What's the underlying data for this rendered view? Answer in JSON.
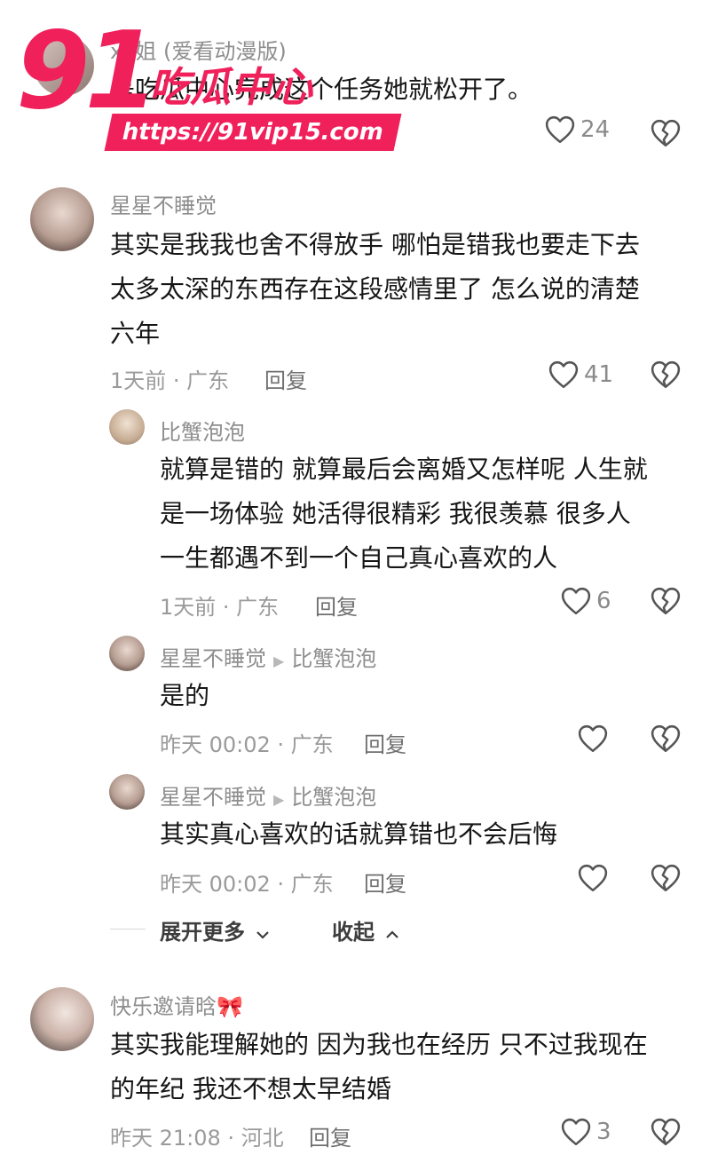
{
  "top_comment": {
    "name": "xx姐 (爱看动漫版)",
    "text": "是吃瓜中心完成这个任务她就松开了。",
    "reply": "回复",
    "likes": "24"
  },
  "comment1": {
    "name": "星星不睡觉",
    "lines": [
      "其实是我我也舍不得放手 哪怕是错我也要走下去",
      "太多太深的东西存在这段感情里了 怎么说的清楚",
      "六年"
    ],
    "time_location": "1天前 · 广东",
    "reply": "回复",
    "likes": "41"
  },
  "reply1": {
    "name": "比蟹泡泡",
    "lines": [
      "就算是错的 就算最后会离婚又怎样呢 人生就",
      "是一场体验 她活得很精彩 我很羡慕 很多人",
      "一生都遇不到一个自己真心喜欢的人"
    ],
    "time_location": "1天前 · 广东",
    "reply": "回复",
    "likes": "6"
  },
  "reply2": {
    "name": "星星不睡觉",
    "to": "比蟹泡泡",
    "text": "是的",
    "time_location": "昨天 00:02 · 广东",
    "reply": "回复"
  },
  "reply3": {
    "name": "星星不睡觉",
    "to": "比蟹泡泡",
    "text": "其实真心喜欢的话就算错也不会后悔",
    "time_location": "昨天 00:02 · 广东",
    "reply": "回复"
  },
  "thread_controls": {
    "expand_more": "展开更多",
    "collapse": "收起"
  },
  "comment2": {
    "name": "快乐邀请晗",
    "lines": [
      "其实我能理解她的 因为我也在经历 只不过我现在",
      "的年纪 我还不想太早结婚"
    ],
    "time_location": "昨天 21:08 · 河北",
    "reply": "回复",
    "likes": "3"
  },
  "watermark": {
    "big": "91",
    "title": "吃瓜中心",
    "url": "https://91vip15.com"
  },
  "colors": {
    "watermark": "#f0205a",
    "meta_text": "#9a9a9a",
    "body_text": "#161616"
  }
}
